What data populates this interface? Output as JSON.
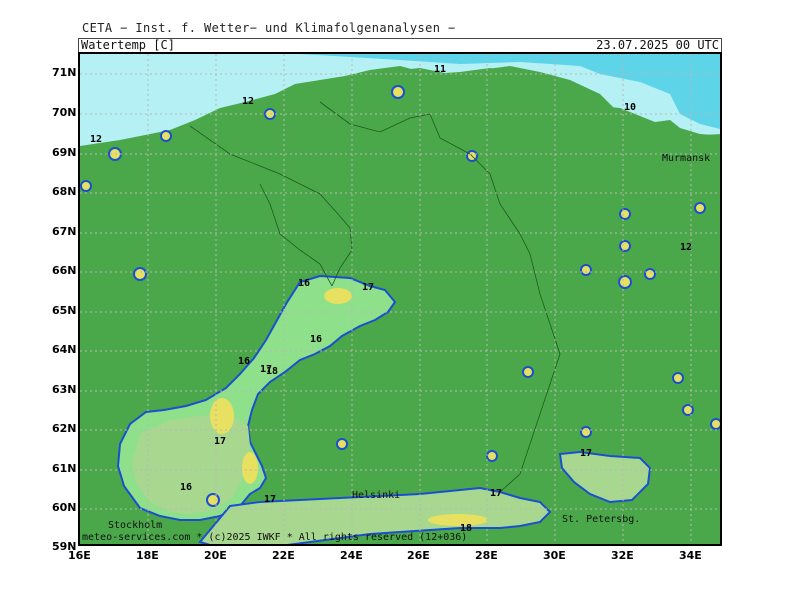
{
  "header": {
    "title": "CETA − Inst. f. Wetter− und Klimafolgenanalysen −",
    "parameter": "Watertemp [C]",
    "datetime": "23.07.2025 00 UTC"
  },
  "axes": {
    "lat_labels": [
      "71N",
      "70N",
      "69N",
      "68N",
      "67N",
      "66N",
      "65N",
      "64N",
      "63N",
      "62N",
      "61N",
      "60N",
      "59N"
    ],
    "lon_labels": [
      "16E",
      "18E",
      "20E",
      "22E",
      "24E",
      "26E",
      "28E",
      "30E",
      "32E",
      "34E"
    ]
  },
  "cities": [
    "Murmansk",
    "Helsinki",
    "Stockholm",
    "St. Petersbg."
  ],
  "contour_labels": [
    "11",
    "12",
    "10",
    "12",
    "12",
    "16",
    "17",
    "16",
    "16",
    "17",
    "18",
    "17",
    "16",
    "17",
    "17",
    "18",
    "17"
  ],
  "footer": "meteo-services.com * (c)2025 IWKF * All rights reserved (12+036)",
  "colors": {
    "land": "#4aa84a",
    "sea_cold": "#5ed4e8",
    "sea_pale": "#b5f0f5",
    "water_17": "#a8d890",
    "water_16": "#8ee08a",
    "water_warm": "#e8e060",
    "contour_blue": "#1a4fd0",
    "contour_black": "#111111"
  }
}
